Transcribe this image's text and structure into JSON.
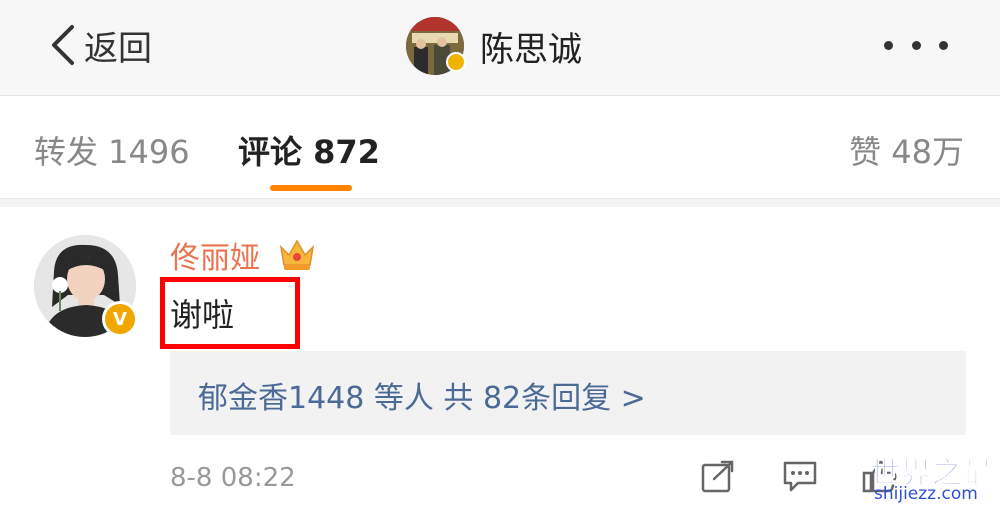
{
  "nav": {
    "back_label": "返回",
    "title": "陈思诚"
  },
  "tabs": {
    "repost": "转发 1496",
    "comment": "评论 872",
    "like": "赞 48万"
  },
  "comment": {
    "author": "佟丽娅",
    "text": "谢啦",
    "replies": "郁金香1448 等人  共 82条回复 >",
    "time": "8-8 08:22"
  },
  "watermark": {
    "brand": "世界之最",
    "domain": "shijiezz.com"
  },
  "colors": {
    "accent": "#ff8200",
    "name": "#eb7350",
    "link": "#4b6a96",
    "highlight": "#ff0000"
  }
}
